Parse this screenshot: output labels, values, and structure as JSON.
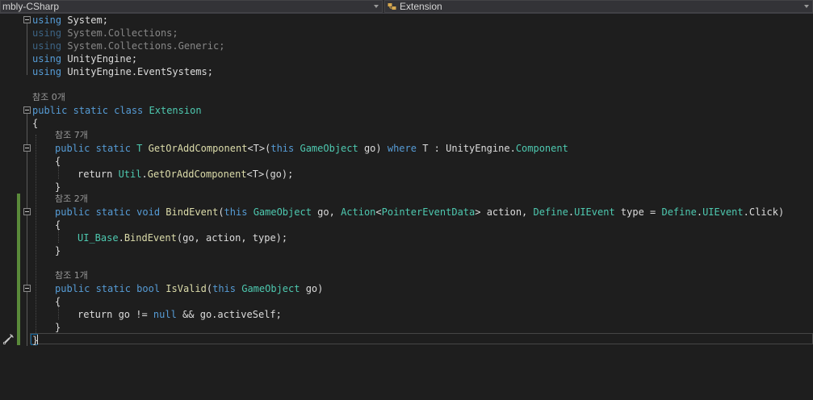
{
  "toolbar": {
    "project_dropdown": "mbly-CSharp",
    "member_dropdown": "Extension"
  },
  "colors": {
    "keyword": "#569cd6",
    "type": "#4ec9b0",
    "method": "#dcdcaa",
    "parameter": "#9cdcfe",
    "text": "#dcdcdc",
    "codelens": "#999999",
    "background": "#1e1e1e",
    "change_marker": "#5a8a3a"
  },
  "code": {
    "l1": {
      "kw": "using",
      "rest": " System;"
    },
    "l2": {
      "kw": "using",
      "rest": " System.Collections;"
    },
    "l3": {
      "kw": "using",
      "rest": " System.Collections.Generic;"
    },
    "l4": {
      "kw": "using",
      "rest": " UnityEngine;"
    },
    "l5": {
      "kw": "using",
      "rest": " UnityEngine.EventSystems;"
    },
    "lens_class": "참조 0개",
    "class_decl": {
      "kw": "public static class",
      "sp": " ",
      "name": "Extension"
    },
    "open_brace": "{",
    "lens_m1": "참조 7개",
    "m1_decl": {
      "a": "public static",
      "b": " T ",
      "c": "GetOrAddComponent",
      "d": "<T>(",
      "e": "this",
      "f": " ",
      "g": "GameObject",
      "h": " go) ",
      "i": "where",
      "j": " T : UnityEngine.",
      "k": "Component"
    },
    "m1_open": "{",
    "m1_body": {
      "a": "return ",
      "b": "Util",
      "c": ".",
      "d": "GetOrAddComponent",
      "e": "<T>(go);"
    },
    "m1_close": "}",
    "lens_m2": "참조 2개",
    "m2_decl": {
      "a": "public static void",
      "b": " ",
      "c": "BindEvent",
      "d": "(",
      "e": "this",
      "f": " ",
      "g": "GameObject",
      "h": " go, ",
      "i": "Action",
      "j": "<",
      "k": "PointerEventData",
      "l": "> action, ",
      "m": "Define",
      "n": ".",
      "o": "UIEvent",
      "p": " type = ",
      "q": "Define",
      "r": ".",
      "s": "UIEvent",
      "t": ".Click)"
    },
    "m2_open": "{",
    "m2_body": {
      "a": "UI_Base",
      "b": ".",
      "c": "BindEvent",
      "d": "(go, action, type);"
    },
    "m2_close": "}",
    "lens_m3": "참조 1개",
    "m3_decl": {
      "a": "public static bool",
      "b": " ",
      "c": "IsValid",
      "d": "(",
      "e": "this",
      "f": " ",
      "g": "GameObject",
      "h": " go)"
    },
    "m3_open": "{",
    "m3_body": {
      "a": "return go != ",
      "b": "null",
      "c": " && go.activeSelf;"
    },
    "m3_close": "}",
    "close_brace": "}"
  }
}
